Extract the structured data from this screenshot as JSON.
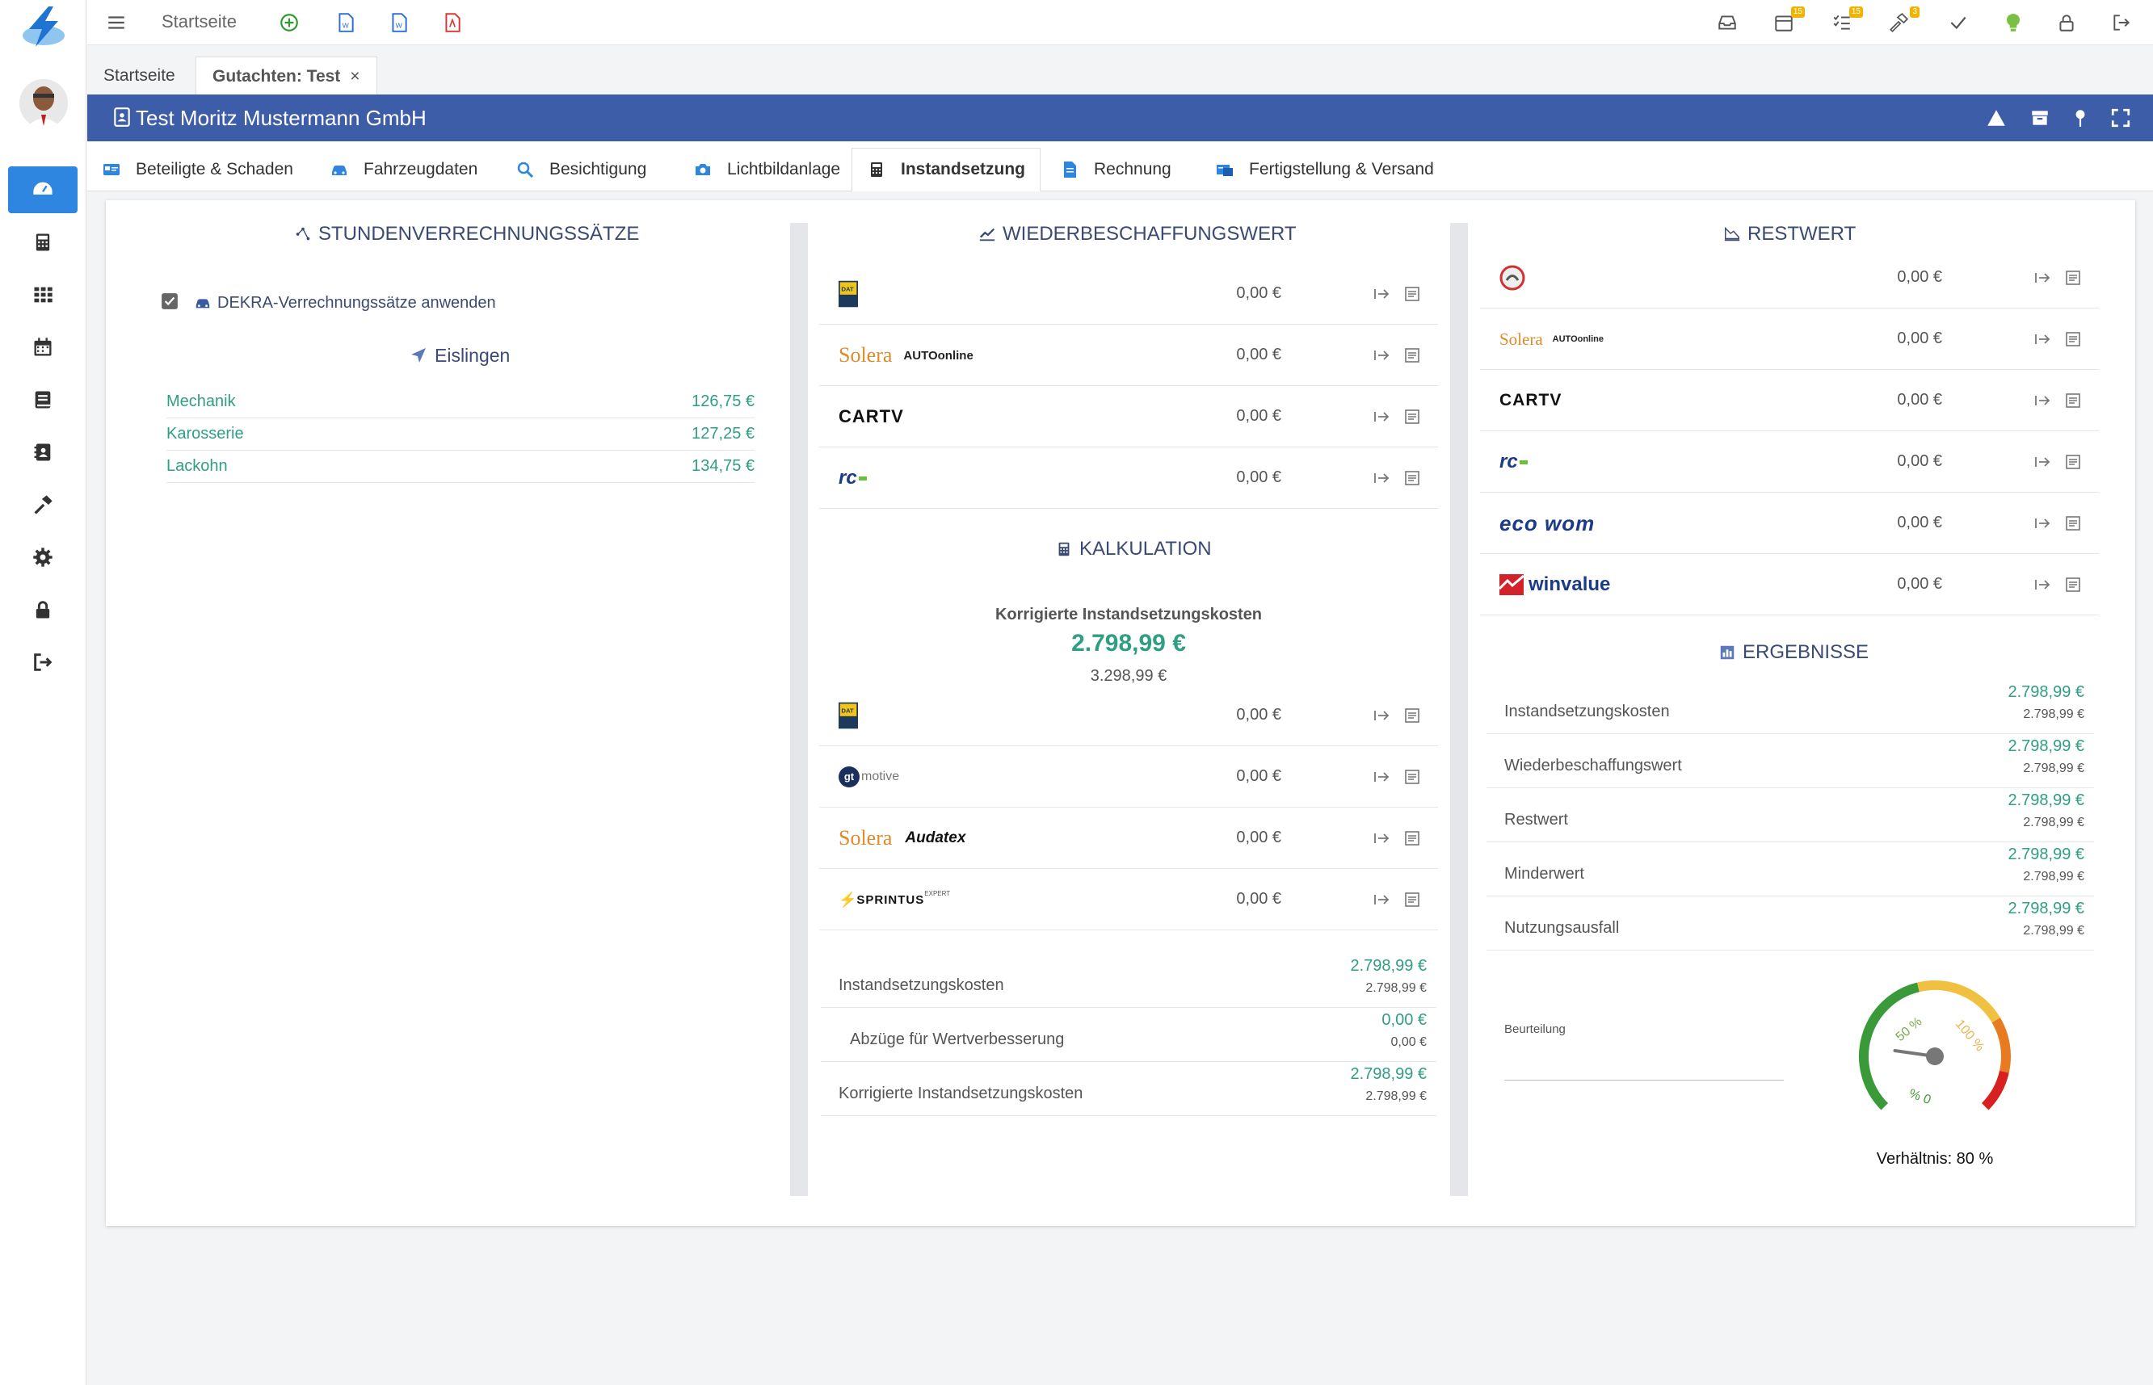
{
  "topbar": {
    "home": "Startseite",
    "badges": {
      "calendar": "15",
      "tasks": "15",
      "tools": "3"
    }
  },
  "doc_tabs": [
    {
      "label": "Startseite"
    },
    {
      "label": "Gutachten: Test",
      "close": "×"
    }
  ],
  "titlebar": {
    "title": "Test Moritz Mustermann GmbH"
  },
  "section_tabs": [
    {
      "label": "Beteiligte & Schaden"
    },
    {
      "label": "Fahrzeugdaten"
    },
    {
      "label": "Besichtigung"
    },
    {
      "label": "Lichtbildanlage"
    },
    {
      "label": "Instandsetzung"
    },
    {
      "label": "Rechnung"
    },
    {
      "label": "Fertigstellung & Versand"
    }
  ],
  "left": {
    "heading": "STUNDENVERRECHNUNGSSÄTZE",
    "checkbox_label": "DEKRA-Verrechnungssätze anwenden",
    "location": "Eislingen",
    "rates": [
      {
        "label": "Mechanik",
        "value": "126,75 €"
      },
      {
        "label": "Karosserie",
        "value": "127,25 €"
      },
      {
        "label": "Lackohn",
        "value": "134,75 €"
      }
    ]
  },
  "middle": {
    "wbw_heading": "WIEDERBESCHAFFUNGSWERT",
    "wbw_rows": [
      {
        "provider": "dat",
        "value": "0,00 €"
      },
      {
        "provider": "solera-autoonline",
        "value": "0,00 €"
      },
      {
        "provider": "cartv",
        "value": "0,00 €"
      },
      {
        "provider": "rc",
        "value": "0,00 €"
      }
    ],
    "kalk_heading": "KALKULATION",
    "kalk_label": "Korrigierte Instandsetzungskosten",
    "kalk_main": "2.798,99 €",
    "kalk_sub": "3.298,99 €",
    "kalk_rows": [
      {
        "provider": "dat",
        "value": "0,00 €"
      },
      {
        "provider": "gt-motive",
        "value": "0,00 €"
      },
      {
        "provider": "solera-audatex",
        "value": "0,00 €"
      },
      {
        "provider": "sprintus",
        "value": "0,00 €"
      }
    ],
    "summary": [
      {
        "label": "Instandsetzungskosten",
        "v1": "2.798,99 €",
        "v2": "2.798,99 €"
      },
      {
        "label": "Abzüge für Wertverbesserung",
        "v1": "0,00 €",
        "v2": "0,00 €"
      },
      {
        "label": "Korrigierte Instandsetzungskosten",
        "v1": "2.798,99 €",
        "v2": "2.798,99 €"
      }
    ]
  },
  "right": {
    "restwert_heading": "RESTWERT",
    "restwert_rows": [
      {
        "provider": "circle",
        "value": "0,00 €"
      },
      {
        "provider": "solera-autoonline",
        "value": "0,00 €"
      },
      {
        "provider": "cartv",
        "value": "0,00 €"
      },
      {
        "provider": "rc",
        "value": "0,00 €"
      },
      {
        "provider": "eco-wom",
        "value": "0,00 €"
      },
      {
        "provider": "winvalue",
        "value": "0,00 €"
      }
    ],
    "ergebnisse_heading": "ERGEBNISSE",
    "ergebnisse": [
      {
        "label": "Instandsetzungskosten",
        "v1": "2.798,99 €",
        "v2": "2.798,99 €"
      },
      {
        "label": "Wiederbeschaffungswert",
        "v1": "2.798,99 €",
        "v2": "2.798,99 €"
      },
      {
        "label": "Restwert",
        "v1": "2.798,99 €",
        "v2": "2.798,99 €"
      },
      {
        "label": "Minderwert",
        "v1": "2.798,99 €",
        "v2": "2.798,99 €"
      },
      {
        "label": "Nutzungsausfall",
        "v1": "2.798,99 €",
        "v2": "2.798,99 €"
      }
    ],
    "beurteilung_label": "Beurteilung",
    "gauge": {
      "ratio_text": "Verhältnis: 80 %",
      "ratio": 0.8,
      "ticks": [
        "% 0",
        "50 %",
        "100 %"
      ]
    }
  },
  "logos": {
    "dat": "DAT",
    "solera": "Solera",
    "autoonline": "AUTOonline",
    "cartv": "CARTV",
    "rc": "rc",
    "gt": "gt",
    "motive": "motive",
    "audatex": "Audatex",
    "sprintus": "SPRINTUS",
    "sprintus_sup": "EXPERT",
    "ecowom": "eco wom",
    "winvalue": "winvalue"
  },
  "colors": {
    "accent": "#3e5da8",
    "green": "#2f9e84",
    "active_side": "#2f86e0"
  }
}
